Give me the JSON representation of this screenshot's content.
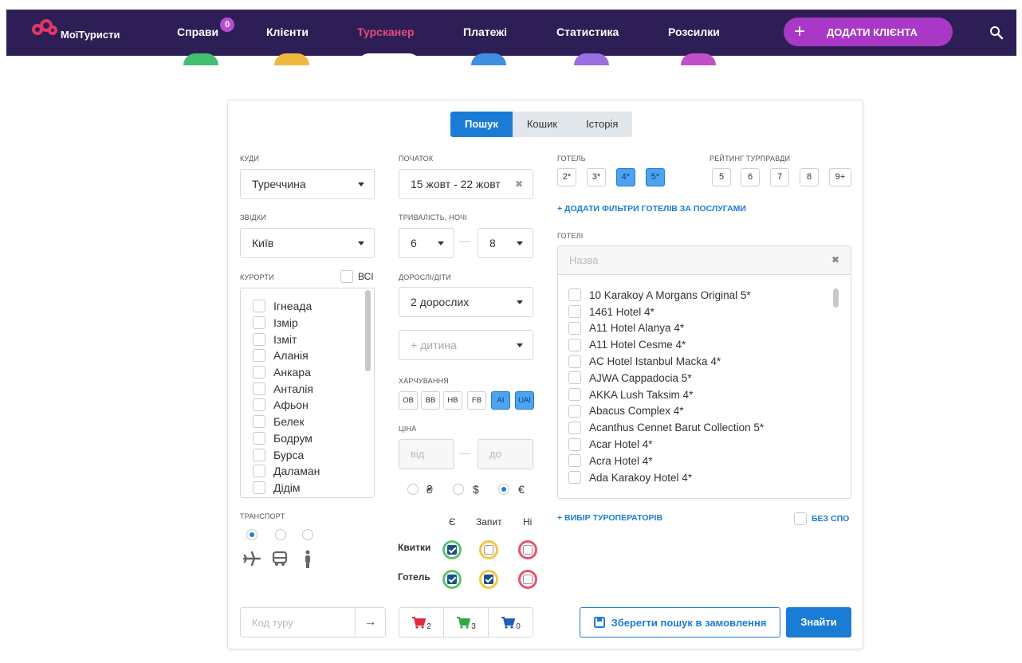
{
  "app": {
    "logo_text": "МоїТуристи"
  },
  "nav": {
    "items": [
      {
        "label": "Справи",
        "badge": "0"
      },
      {
        "label": "Клієнти"
      },
      {
        "label": "Турсканер",
        "active": true
      },
      {
        "label": "Платежі"
      },
      {
        "label": "Статистика"
      },
      {
        "label": "Розсилки"
      }
    ],
    "add_client_label": "ДОДАТИ КЛІЄНТА",
    "add_icon": "+",
    "search_icon": "search-icon"
  },
  "tabs": [
    "Пошук",
    "Кошик",
    "Історія"
  ],
  "destination": {
    "label": "КУДИ",
    "value": "Туреччина"
  },
  "origin": {
    "label": "ЗВІДКИ",
    "value": "Київ"
  },
  "resorts": {
    "label": "КУРОРТИ",
    "all_label": "ВСІ",
    "items": [
      "Ігнеада",
      "Ізмір",
      "Ізміт",
      "Аланія",
      "Анкара",
      "Анталія",
      "Афьон",
      "Белек",
      "Бодрум",
      "Бурса",
      "Даламан",
      "Дідім"
    ]
  },
  "start": {
    "label": "ПОЧАТОК",
    "value": "15 жовт - 22 жовт",
    "clear_icon": "✖"
  },
  "duration": {
    "label": "ТРИВАЛІСТЬ, НОЧІ",
    "from": "6",
    "to": "8",
    "dash": "—"
  },
  "travelers": {
    "label": "ДОРОСЛІ/ДІТИ",
    "adults": "2 дорослих",
    "child_placeholder": "+ дитина"
  },
  "meals": {
    "label": "ХАРЧУВАННЯ",
    "options": [
      "OB",
      "BB",
      "HB",
      "FB",
      "AI",
      "UAI"
    ],
    "selected": [
      "AI",
      "UAI"
    ]
  },
  "price": {
    "label": "ЦІНА",
    "from_placeholder": "від",
    "to_placeholder": "до",
    "dash": "—",
    "currencies": [
      "₴",
      "$",
      "€"
    ],
    "selected_currency": "€"
  },
  "transport": {
    "label": "ТРАНСПОРТ",
    "icons": [
      "plane-icon",
      "bus-icon",
      "person-icon"
    ],
    "selected": 0
  },
  "availability": {
    "headers": [
      "Є",
      "Запит",
      "Ні"
    ],
    "rows": [
      {
        "label": "Квитки",
        "checked": [
          true,
          false,
          false
        ]
      },
      {
        "label": "Готель",
        "checked": [
          true,
          true,
          false
        ]
      }
    ],
    "colors": {
      "yes": "#5cc46a",
      "request": "#f5c542",
      "no": "#e8536a"
    }
  },
  "hotel_stars": {
    "label": "ГОТЕЛЬ",
    "options": [
      "2*",
      "3*",
      "4*",
      "5*"
    ],
    "selected": [
      "4*",
      "5*"
    ]
  },
  "rating": {
    "label": "РЕЙТИНГ ТУРПРАВДИ",
    "options": [
      "5",
      "6",
      "7",
      "8",
      "9+"
    ]
  },
  "hotel_filters_link": "+ ДОДАТИ ФІЛЬТРИ ГОТЕЛІВ ЗА ПОСЛУГАМИ",
  "hotels": {
    "label": "ГОТЕЛІ",
    "search_placeholder": "Назва",
    "clear_icon": "✖",
    "items": [
      "10 Karakoy A Morgans Original 5*",
      "1461 Hotel 4*",
      "A11 Hotel Alanya 4*",
      "A11 Hotel Cesme 4*",
      "AC Hotel Istanbul Macka 4*",
      "AJWA Cappadocia 5*",
      "AKKA Lush Taksim 4*",
      "Abacus Complex 4*",
      "Acanthus Cennet Barut Collection 5*",
      "Acar Hotel 4*",
      "Acra Hotel 4*",
      "Ada Karakoy Hotel 4*"
    ]
  },
  "operators_link": "+ ВИБІР ТУРОПЕРАТОРІВ",
  "no_spo_label": "БЕЗ СПО",
  "tour_code": {
    "placeholder": "Код туру",
    "go_icon": "→"
  },
  "carts": [
    {
      "count": "2",
      "color": "#e0283c"
    },
    {
      "count": "3",
      "color": "#2fa84a"
    },
    {
      "count": "0",
      "color": "#1b5fc2"
    }
  ],
  "save_label": "Зберегти пошук в замовлення",
  "find_label": "Знайти"
}
